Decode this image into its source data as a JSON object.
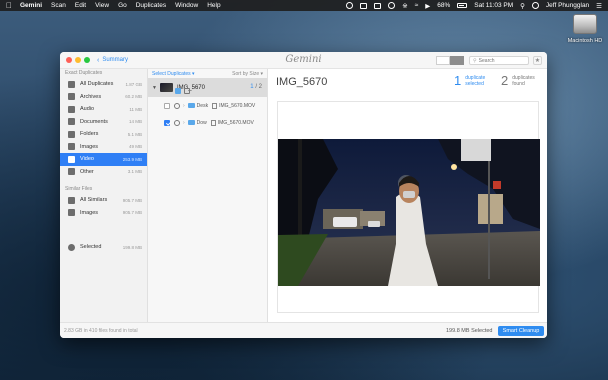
{
  "menubar": {
    "apple_icon": "apple-icon",
    "app_name": "Gemini",
    "items": [
      "Scan",
      "Edit",
      "View",
      "Go",
      "Duplicates",
      "Window",
      "Help"
    ],
    "battery": "68%",
    "clock": "Sat 11:03 PM",
    "user": "Jeff Phungglan"
  },
  "desktop": {
    "drive_label": "Macintosh HD"
  },
  "window": {
    "back_label": "Summary",
    "app_title": "Gemini",
    "search_placeholder": "Search"
  },
  "sidebar": {
    "exact_header": "Exact Duplicates",
    "exact_items": [
      {
        "label": "All Duplicates",
        "size": "1.87 GB",
        "icon": "duplicates-icon"
      },
      {
        "label": "Archives",
        "size": "60.2 MB",
        "icon": "archive-icon"
      },
      {
        "label": "Audio",
        "size": "11 MB",
        "icon": "music-icon"
      },
      {
        "label": "Documents",
        "size": "14 MB",
        "icon": "document-icon"
      },
      {
        "label": "Folders",
        "size": "5.1 MB",
        "icon": "folder-icon"
      },
      {
        "label": "Images",
        "size": "49 MB",
        "icon": "image-icon"
      },
      {
        "label": "Video",
        "size": "253.9 MB",
        "icon": "video-icon"
      },
      {
        "label": "Other",
        "size": "3.1 MB",
        "icon": "other-icon"
      }
    ],
    "similar_header": "Similar Files",
    "similar_items": [
      {
        "label": "All Similars",
        "size": "905.7 MB",
        "icon": "similars-icon"
      },
      {
        "label": "Images",
        "size": "905.7 MB",
        "icon": "image-icon"
      }
    ],
    "selected_item": {
      "label": "Selected",
      "size": "199.8 MB",
      "icon": "selected-icon"
    }
  },
  "filelist": {
    "select_duplicates": "Select Duplicates ▾",
    "sort_by": "Sort by Size ▾",
    "group": {
      "name": "IMG_5670",
      "selected_count": "1",
      "separator": "/",
      "total": "2"
    },
    "files": [
      {
        "checked": false,
        "folder": "Desk",
        "sep": "›",
        "name": "IMG_5670.MOV"
      },
      {
        "checked": true,
        "folder": "Dow",
        "sep": "›",
        "name": "IMG_5670.MOV"
      }
    ]
  },
  "detail": {
    "title": "IMG_5670",
    "duplicates_selected_num": "1",
    "duplicates_selected_label": "duplicate selected",
    "duplicates_found_num": "2",
    "duplicates_found_label": "duplicates found"
  },
  "bottombar": {
    "summary": "2.83 GB in 410 files found in total",
    "selected": "199.8 MB Selected",
    "cleanup_label": "Smart Cleanup"
  },
  "colors": {
    "accent": "#2f8cf0",
    "selection": "#2f7ff5"
  }
}
